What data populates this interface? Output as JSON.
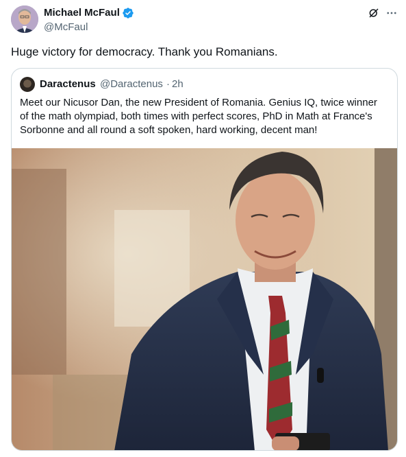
{
  "tweet": {
    "author_name": "Michael McFaul",
    "author_handle": "@McFaul",
    "verified_icon": "verified-badge-icon",
    "text": "Huge victory for democracy. Thank you Romanians.",
    "actions": {
      "grok_icon": "grok-icon",
      "more_icon": "more-options-icon"
    }
  },
  "quote": {
    "author_name": "Daractenus",
    "author_handle": "@Daractenus",
    "separator": "·",
    "time": "2h",
    "text_lines": [
      "Meet our Nicusor Dan, the new President of Romania. Genius IQ, twice winner",
      "of the math olympiad, both times with perfect scores, PhD in Math at France's",
      "Sorbonne and all round a soft spoken, hard working, decent man!"
    ]
  },
  "colors": {
    "text": "#0f1419",
    "secondary": "#536471",
    "border": "#cfd9de",
    "verified": "#1d9bf0"
  }
}
